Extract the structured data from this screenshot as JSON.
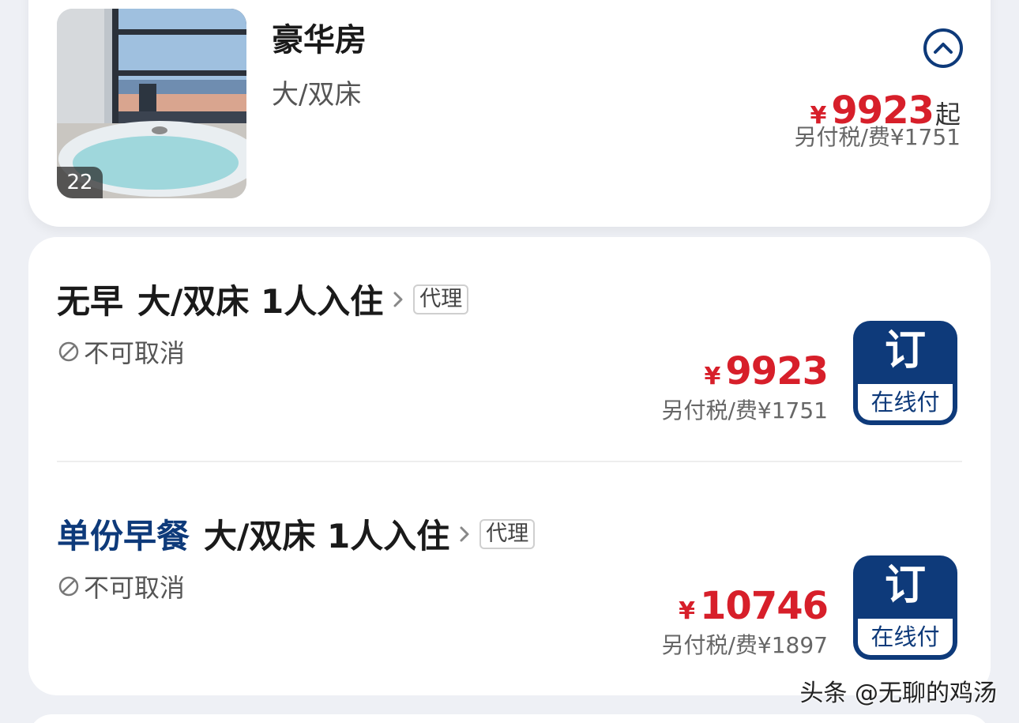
{
  "room": {
    "name": "豪华房",
    "bed_type": "大/双床",
    "photo_count": "22",
    "currency": "¥",
    "price": "9923",
    "price_suffix": "起",
    "tax_note": "另付税/费¥1751"
  },
  "plans": [
    {
      "meal": "无早",
      "desc": "大/双床 1人入住",
      "tag": "代理",
      "cancel_rule": "不可取消",
      "currency": "¥",
      "price": "9923",
      "tax_note": "另付税/费¥1751",
      "book_label": "订",
      "pay_label": "在线付"
    },
    {
      "meal": "单份早餐",
      "desc": "大/双床 1人入住",
      "tag": "代理",
      "cancel_rule": "不可取消",
      "currency": "¥",
      "price": "10746",
      "tax_note": "另付税/费¥1897",
      "book_label": "订",
      "pay_label": "在线付"
    }
  ],
  "watermark": "头条 @无聊的鸡汤",
  "colors": {
    "brand_blue": "#0e3a7a",
    "price_red": "#d71f2a",
    "background": "#eef0f5"
  },
  "icons": {
    "collapse": "chevron-up-circle-icon",
    "detail": "chevron-right-icon",
    "cancel": "ban-icon"
  }
}
